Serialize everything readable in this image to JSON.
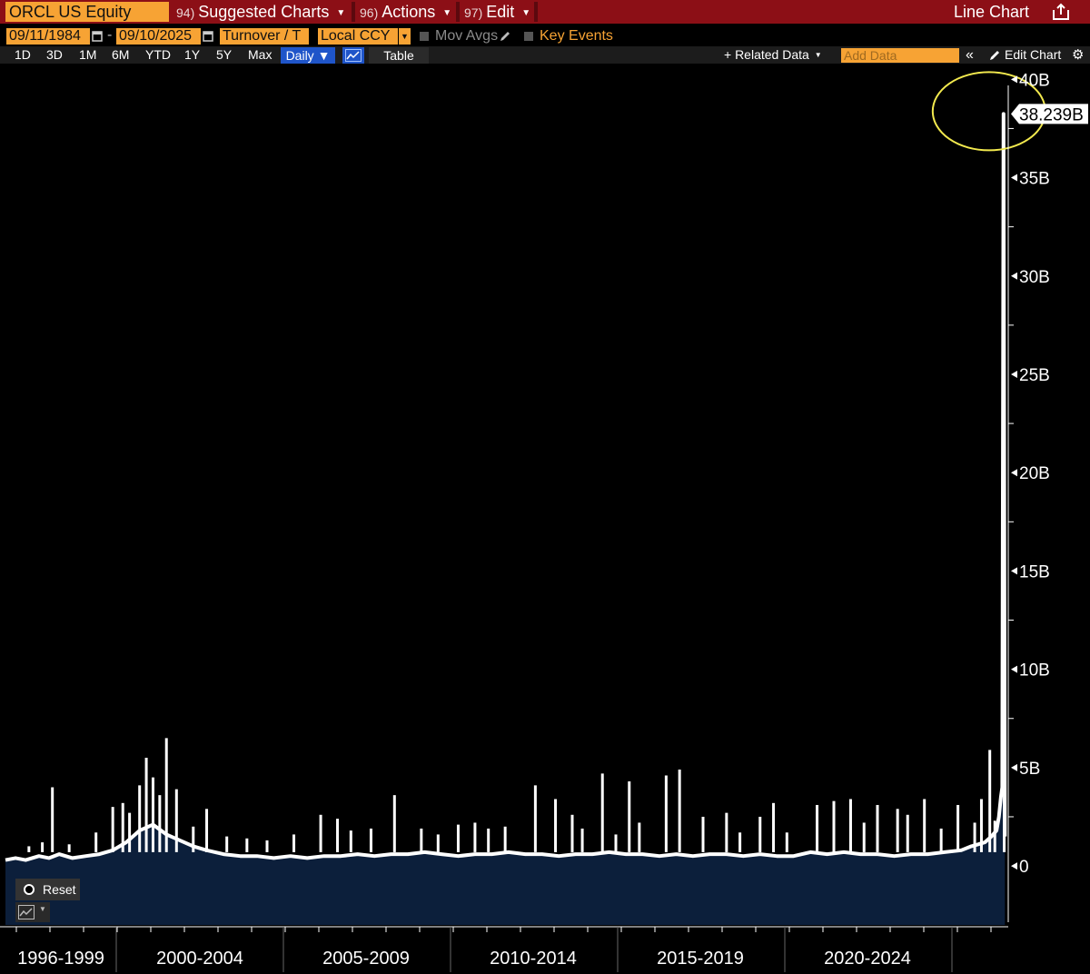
{
  "header": {
    "ticker": "ORCL US Equity",
    "menus": [
      {
        "num": "94)",
        "label": "Suggested Charts"
      },
      {
        "num": "96)",
        "label": "Actions"
      },
      {
        "num": "97)",
        "label": "Edit"
      }
    ],
    "right_title": "Line Chart"
  },
  "controls": {
    "start_date": "09/11/1984",
    "end_date": "09/10/2025",
    "dash": "-",
    "field": "Turnover / T",
    "currency": "Local CCY",
    "mov_avgs": "Mov Avgs",
    "key_events": "Key Events",
    "ranges": [
      "1D",
      "3D",
      "1M",
      "6M",
      "YTD",
      "1Y",
      "5Y",
      "Max"
    ],
    "frequency": "Daily ▼",
    "table": "Table",
    "related_data": "+ Related Data",
    "add_data_placeholder": "Add Data",
    "edit_chart": "Edit Chart",
    "reset": "Reset"
  },
  "colors": {
    "accent_orange": "#f7a334",
    "topbar_red": "#8c0f16",
    "area_fill": "#0c1f3b",
    "line": "#ffffff",
    "highlight_circle": "#f2e94e",
    "active_blue": "#1f55c9"
  },
  "chart_data": {
    "type": "area",
    "title": "",
    "ylabel": "",
    "ylim": [
      -3,
      40.8
    ],
    "y_ticks": [
      0,
      5,
      10,
      15,
      20,
      25,
      30,
      35,
      40
    ],
    "y_tick_labels": [
      "0",
      "5B",
      "10B",
      "15B",
      "20B",
      "25B",
      "30B",
      "35B",
      "40B"
    ],
    "x_period_labels": [
      "1996-1999",
      "2000-2004",
      "2005-2009",
      "2010-2014",
      "2015-2019",
      "2020-2024"
    ],
    "xlim": [
      1996.0,
      2025.9
    ],
    "last_value_label": "38.239B",
    "last_value": 38.239,
    "series": [
      {
        "x": [
          1996.0,
          1996.3,
          1996.6,
          1997.0,
          1997.3,
          1997.6,
          1998.0,
          1998.4,
          1998.8,
          1999.2,
          1999.6,
          2000.0,
          2000.4,
          2000.8,
          2001.2,
          2001.6,
          2002.0,
          2002.5,
          2003.0,
          2003.5,
          2004.0,
          2004.5,
          2005.0,
          2005.5,
          2006.0,
          2006.5,
          2007.0,
          2007.5,
          2008.0,
          2008.5,
          2009.0,
          2009.5,
          2010.0,
          2010.5,
          2011.0,
          2011.5,
          2012.0,
          2012.5,
          2013.0,
          2013.5,
          2014.0,
          2014.5,
          2015.0,
          2015.5,
          2016.0,
          2016.5,
          2017.0,
          2017.5,
          2018.0,
          2018.5,
          2019.0,
          2019.5,
          2020.0,
          2020.5,
          2021.0,
          2021.5,
          2022.0,
          2022.5,
          2023.0,
          2023.5,
          2024.0,
          2024.5,
          2024.8,
          2025.0,
          2025.2,
          2025.4,
          2025.55,
          2025.62,
          2025.68,
          2025.72,
          2025.76,
          2025.8
        ],
        "y": [
          0.3,
          0.4,
          0.3,
          0.5,
          0.4,
          0.6,
          0.4,
          0.5,
          0.6,
          0.8,
          1.2,
          1.8,
          2.1,
          1.6,
          1.3,
          1.0,
          0.8,
          0.6,
          0.5,
          0.5,
          0.4,
          0.5,
          0.4,
          0.5,
          0.5,
          0.6,
          0.5,
          0.6,
          0.6,
          0.7,
          0.6,
          0.5,
          0.6,
          0.6,
          0.7,
          0.6,
          0.6,
          0.5,
          0.6,
          0.6,
          0.7,
          0.6,
          0.6,
          0.5,
          0.6,
          0.5,
          0.6,
          0.6,
          0.5,
          0.6,
          0.5,
          0.5,
          0.7,
          0.6,
          0.7,
          0.6,
          0.6,
          0.5,
          0.6,
          0.6,
          0.7,
          0.8,
          1.0,
          1.1,
          1.2,
          1.5,
          1.8,
          2.5,
          3.5,
          4.0,
          38.239,
          1.5
        ]
      }
    ],
    "spikes": [
      {
        "x": 1996.7,
        "y": 1.0
      },
      {
        "x": 1997.1,
        "y": 1.2
      },
      {
        "x": 1997.4,
        "y": 4.0
      },
      {
        "x": 1997.9,
        "y": 1.1
      },
      {
        "x": 1998.7,
        "y": 1.7
      },
      {
        "x": 1999.2,
        "y": 3.0
      },
      {
        "x": 1999.5,
        "y": 3.2
      },
      {
        "x": 1999.7,
        "y": 2.7
      },
      {
        "x": 2000.0,
        "y": 4.1
      },
      {
        "x": 2000.2,
        "y": 5.5
      },
      {
        "x": 2000.4,
        "y": 4.5
      },
      {
        "x": 2000.6,
        "y": 3.6
      },
      {
        "x": 2000.8,
        "y": 6.5
      },
      {
        "x": 2001.1,
        "y": 3.9
      },
      {
        "x": 2001.6,
        "y": 2.0
      },
      {
        "x": 2002.0,
        "y": 2.9
      },
      {
        "x": 2002.6,
        "y": 1.5
      },
      {
        "x": 2003.2,
        "y": 1.4
      },
      {
        "x": 2003.8,
        "y": 1.3
      },
      {
        "x": 2004.6,
        "y": 1.6
      },
      {
        "x": 2005.4,
        "y": 2.6
      },
      {
        "x": 2005.9,
        "y": 2.4
      },
      {
        "x": 2006.3,
        "y": 1.8
      },
      {
        "x": 2006.9,
        "y": 1.9
      },
      {
        "x": 2007.6,
        "y": 3.6
      },
      {
        "x": 2008.4,
        "y": 1.9
      },
      {
        "x": 2008.9,
        "y": 1.6
      },
      {
        "x": 2009.5,
        "y": 2.1
      },
      {
        "x": 2010.0,
        "y": 2.2
      },
      {
        "x": 2010.4,
        "y": 1.9
      },
      {
        "x": 2010.9,
        "y": 2.0
      },
      {
        "x": 2011.8,
        "y": 4.1
      },
      {
        "x": 2012.4,
        "y": 3.4
      },
      {
        "x": 2012.9,
        "y": 2.6
      },
      {
        "x": 2013.2,
        "y": 1.9
      },
      {
        "x": 2013.8,
        "y": 4.7
      },
      {
        "x": 2014.2,
        "y": 1.6
      },
      {
        "x": 2014.6,
        "y": 4.3
      },
      {
        "x": 2014.9,
        "y": 2.2
      },
      {
        "x": 2015.7,
        "y": 4.6
      },
      {
        "x": 2016.1,
        "y": 4.9
      },
      {
        "x": 2016.8,
        "y": 2.5
      },
      {
        "x": 2017.5,
        "y": 2.7
      },
      {
        "x": 2017.9,
        "y": 1.7
      },
      {
        "x": 2018.5,
        "y": 2.5
      },
      {
        "x": 2018.9,
        "y": 3.2
      },
      {
        "x": 2019.3,
        "y": 1.7
      },
      {
        "x": 2020.2,
        "y": 3.1
      },
      {
        "x": 2020.7,
        "y": 3.3
      },
      {
        "x": 2021.2,
        "y": 3.4
      },
      {
        "x": 2021.6,
        "y": 2.2
      },
      {
        "x": 2022.0,
        "y": 3.1
      },
      {
        "x": 2022.6,
        "y": 2.9
      },
      {
        "x": 2022.9,
        "y": 2.6
      },
      {
        "x": 2023.4,
        "y": 3.4
      },
      {
        "x": 2023.9,
        "y": 1.9
      },
      {
        "x": 2024.4,
        "y": 3.1
      },
      {
        "x": 2024.9,
        "y": 2.2
      },
      {
        "x": 2025.1,
        "y": 3.4
      },
      {
        "x": 2025.35,
        "y": 5.9
      },
      {
        "x": 2025.5,
        "y": 2.3
      },
      {
        "x": 2025.78,
        "y": 5.0
      }
    ]
  }
}
